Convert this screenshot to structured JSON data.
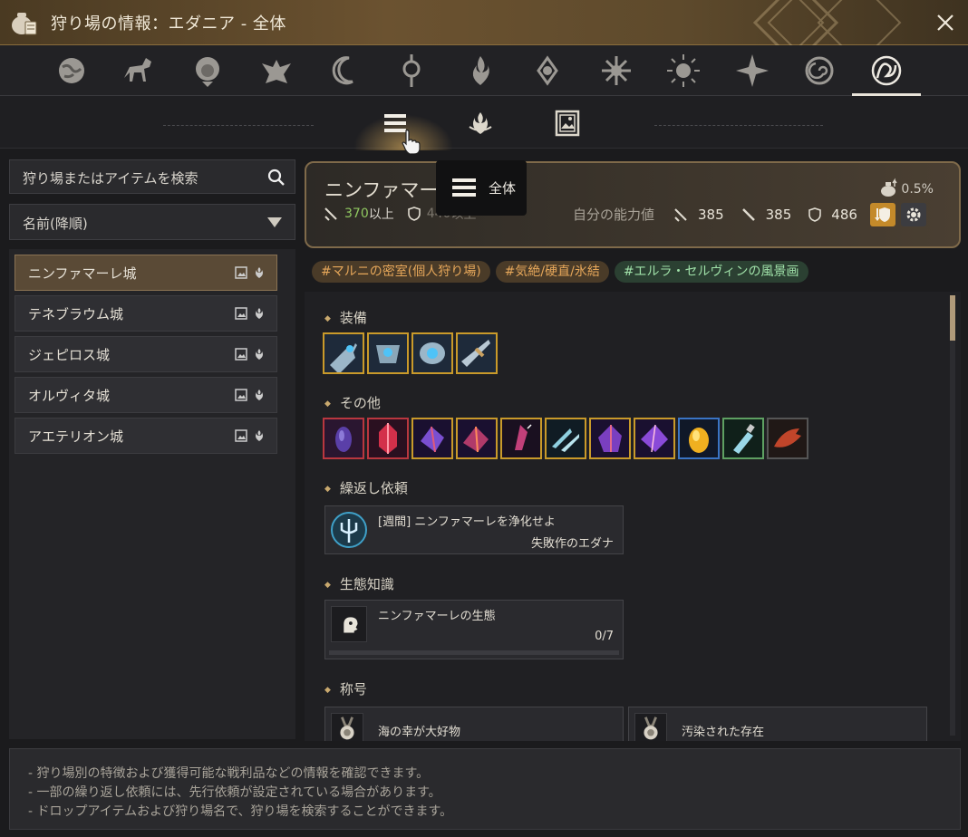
{
  "window": {
    "title": "狩り場の情報：エダニア - 全体"
  },
  "tabs": [
    {
      "icon": "globe-icon"
    },
    {
      "icon": "horse-icon"
    },
    {
      "icon": "lion-icon"
    },
    {
      "icon": "eagle-icon"
    },
    {
      "icon": "moon-icon"
    },
    {
      "icon": "orb-icon"
    },
    {
      "icon": "flame-icon"
    },
    {
      "icon": "lotus-icon"
    },
    {
      "icon": "star-burst-icon"
    },
    {
      "icon": "sun-icon"
    },
    {
      "icon": "compass-star-icon"
    },
    {
      "icon": "spiral-icon"
    },
    {
      "icon": "edania-emblem-icon",
      "active": true
    }
  ],
  "subtabs": [
    {
      "icon": "list-icon",
      "active": true
    },
    {
      "icon": "crown-flame-icon"
    },
    {
      "icon": "picture-frame-icon"
    }
  ],
  "tooltip": {
    "label": "全体"
  },
  "search": {
    "placeholder": "狩り場またはアイテムを検索"
  },
  "sort": {
    "value": "名前(降順)"
  },
  "zones": [
    {
      "name": "ニンファマーレ城",
      "selected": true
    },
    {
      "name": "テネブラウム城"
    },
    {
      "name": "ジェピロス城"
    },
    {
      "name": "オルヴィタ城"
    },
    {
      "name": "アエテリオン城"
    }
  ],
  "banner": {
    "name": "ニンファマー",
    "name_suffix": "レ",
    "ap_req": "370",
    "ap_suffix": "以上",
    "dp_req": "440",
    "dp_suffix": "以上",
    "ability_label": "自分の能力値",
    "ap": "385",
    "awk_ap": "385",
    "dp": "486",
    "drop_rate": "0.5%"
  },
  "tags": [
    "#マルニの密室(個人狩り場)",
    "#気絶/硬直/氷結",
    "#エルラ・セルヴィンの風景画"
  ],
  "sections": {
    "equipment": "装備",
    "other": "その他",
    "repeat_quests": "繰返し依頼",
    "ecology": "生態知識",
    "titles": "称号"
  },
  "equipment_items": [
    {
      "name": "equip-1",
      "grade": "gold"
    },
    {
      "name": "equip-2",
      "grade": "gold"
    },
    {
      "name": "equip-3",
      "grade": "gold"
    },
    {
      "name": "equip-4",
      "grade": "gold"
    }
  ],
  "other_items": [
    {
      "grade": "red",
      "color": "#5a3fa8"
    },
    {
      "grade": "red",
      "color": "#d3304a"
    },
    {
      "grade": "gold",
      "color": "#7a4fd0"
    },
    {
      "grade": "gold",
      "color": "#b03a6a"
    },
    {
      "grade": "gold",
      "color": "#c2407a"
    },
    {
      "grade": "gold",
      "color": "#8fd0e0"
    },
    {
      "grade": "gold",
      "color": "#7a3fc0"
    },
    {
      "grade": "gold",
      "color": "#8a4ad8"
    },
    {
      "grade": "blue",
      "color": "#f0b020"
    },
    {
      "grade": "green",
      "color": "#9ad8e8"
    },
    {
      "grade": "gray",
      "color": "#c0452a"
    }
  ],
  "quest": {
    "title": "[週間] ニンファマーレを浄化せよ",
    "npc": "失敗作のエダナ"
  },
  "ecology": {
    "title": "ニンファマーレの生態",
    "count": "0/7",
    "progress": 0
  },
  "titles": [
    {
      "label": "海の幸が大好物"
    },
    {
      "label": "汚染された存在"
    }
  ],
  "footer": [
    "- 狩り場別の特徴および獲得可能な戦利品などの情報を確認できます。",
    "- 一部の繰り返し依頼には、先行依頼が設定されている場合があります。",
    "- ドロップアイテムおよび狩り場名で、狩り場を検索することができます。"
  ]
}
